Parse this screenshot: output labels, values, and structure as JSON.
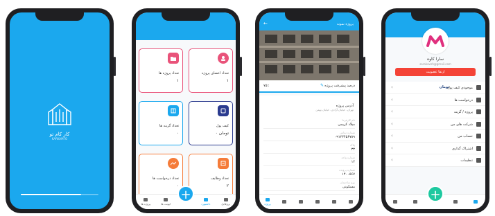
{
  "splash": {
    "app_name": "کار کام تو",
    "app_sub": "KARKAMTO",
    "progress": 0.78
  },
  "dashboard": {
    "cards": [
      {
        "label": "تعداد اعضای پروژه",
        "value": "۱",
        "color": "#e9537a"
      },
      {
        "label": "تعداد پروژه ها",
        "value": "۱",
        "color": "#e9537a"
      },
      {
        "label": "کیف پول",
        "value": "۰ تومان",
        "color": "#2b3b8f"
      },
      {
        "label": "تعداد گزینه ها",
        "value": "۰",
        "color": "#1ba8ee"
      },
      {
        "label": "تعداد وظایف",
        "value": "۲",
        "color": "#f57c3a"
      },
      {
        "label": "تعداد درخواست ها",
        "value": "۰",
        "color": "#f57c3a"
      }
    ],
    "tabs": [
      "پروفایل",
      "داشبورد",
      "",
      "ایونت ها",
      "پروژه ها"
    ]
  },
  "project": {
    "title": "پروژه نمونه",
    "tab_left": "۷۵٪",
    "tab_right": "درصد پیشرفت پروژه",
    "header": "آدرس پروژه",
    "header_sub": "تهران، خیابان آزادی، خیابان بهمن",
    "rows": [
      {
        "k": "نام کارفرما",
        "v": "میلاد کریمی"
      },
      {
        "k": "شماره تماس",
        "v": "۰۹۱۲۳۴۵۶۷۸۹"
      },
      {
        "k": "پلاک",
        "v": "۳۳"
      },
      {
        "k": "شماره واحد",
        "v": "۱۲"
      },
      {
        "k": "شماره پرونده",
        "v": "۱۴۰۰۵۶۷"
      },
      {
        "k": "نوع ساختمان",
        "v": "مسکونی"
      }
    ],
    "tabs": [
      "پروژه",
      "",
      "",
      "",
      "",
      "",
      ""
    ]
  },
  "profile": {
    "name": "سارا کاوه",
    "email": "sarakaveh@gmail.com",
    "logout": "ارتقا عضویت",
    "menu": [
      {
        "label": "موجودی کیف پول",
        "badge": "تومان"
      },
      {
        "label": "درخواست ها",
        "badge": ""
      },
      {
        "label": "پروژه / گزینه",
        "badge": ""
      },
      {
        "label": "شرکت های من",
        "badge": ""
      },
      {
        "label": "حساب من",
        "badge": ""
      },
      {
        "label": "اشتراک گذاری",
        "badge": ""
      },
      {
        "label": "تنظیمات",
        "badge": ""
      }
    ]
  }
}
